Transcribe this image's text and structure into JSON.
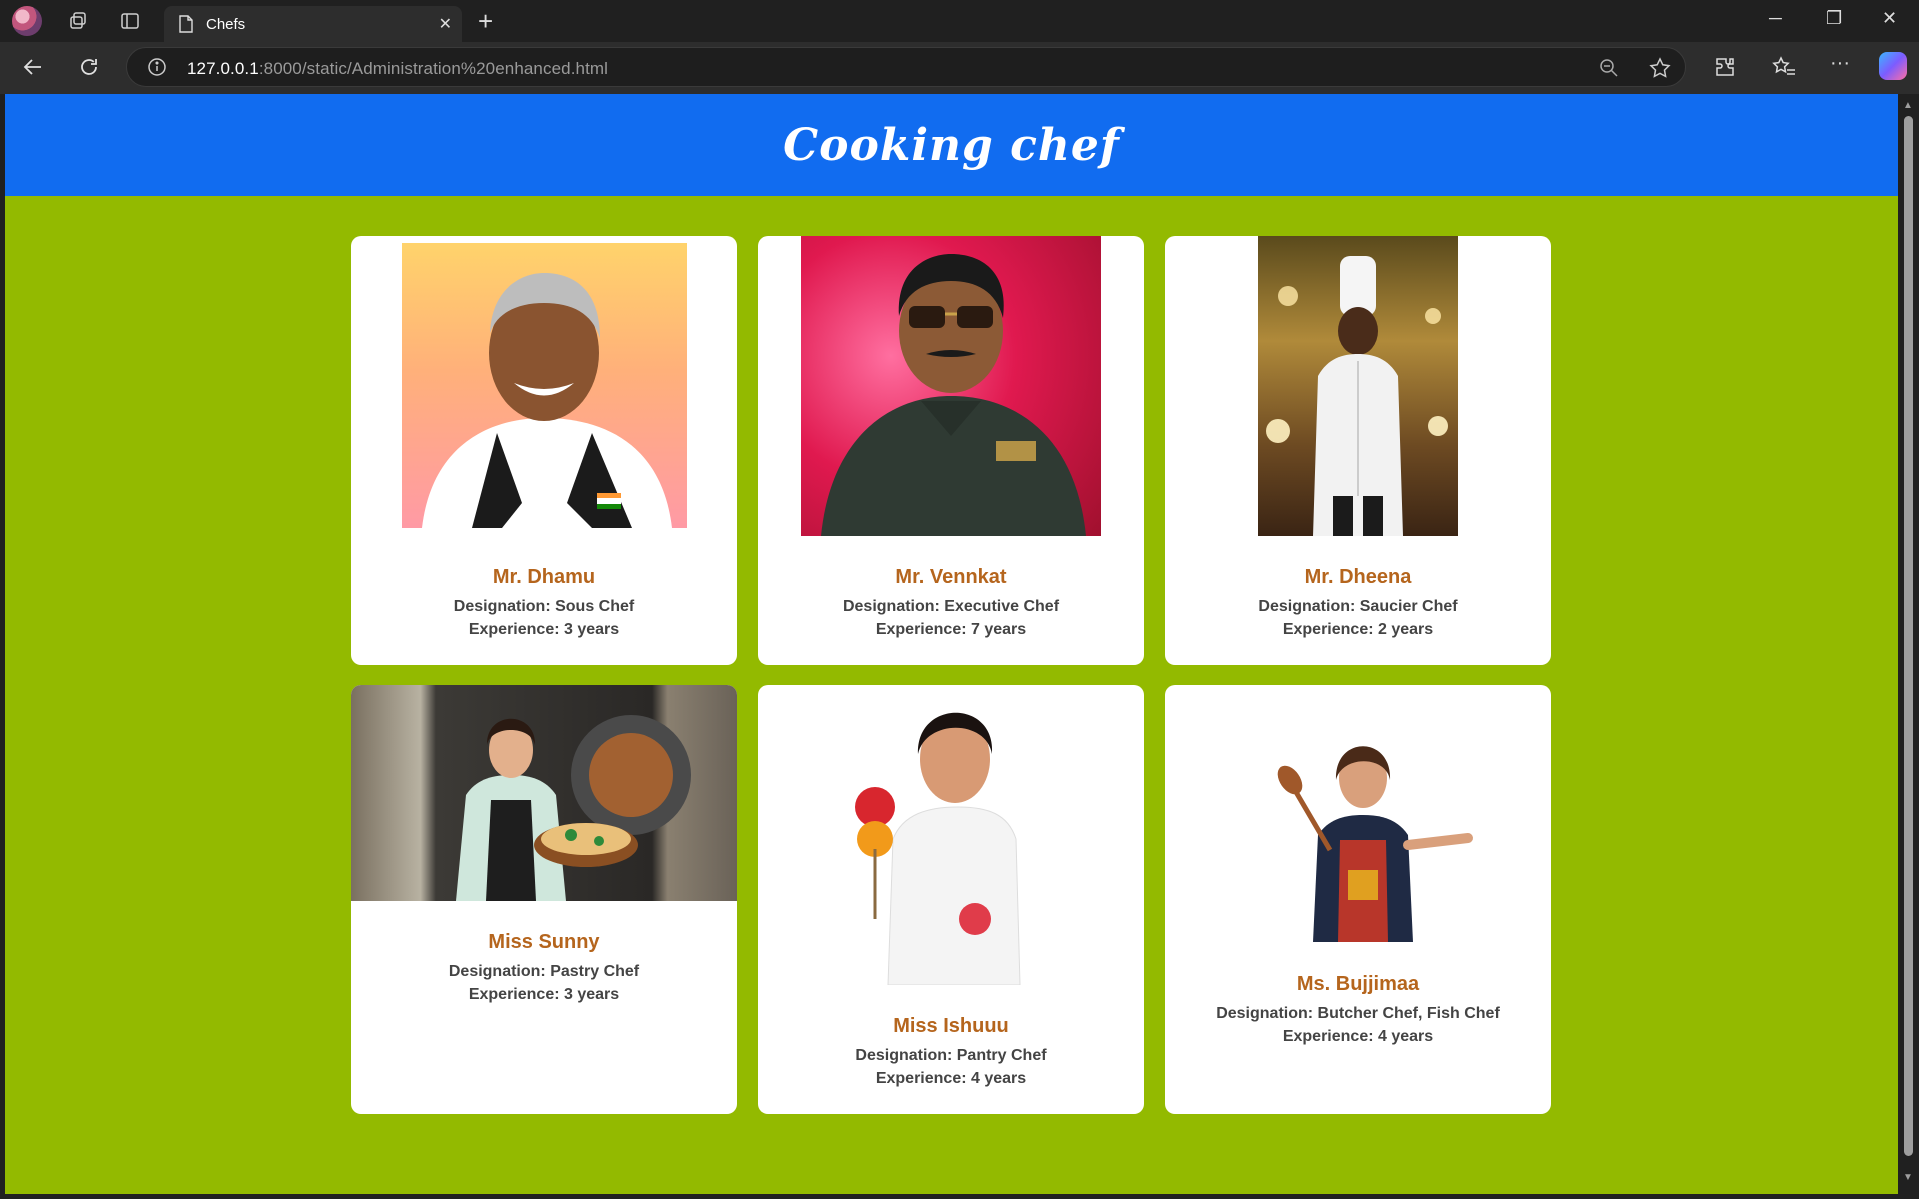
{
  "browser": {
    "tab_title": "Chefs",
    "url_host": "127.0.0.1",
    "url_rest": ":8000/static/Administration%20enhanced.html"
  },
  "page": {
    "heading": "Cooking chef"
  },
  "chefs": [
    {
      "name": "Mr. Dhamu",
      "designation": "Designation: Sous Chef",
      "experience": "Experience: 3 years"
    },
    {
      "name": "Mr. Vennkat",
      "designation": "Designation: Executive Chef",
      "experience": "Experience: 7 years"
    },
    {
      "name": "Mr. Dheena",
      "designation": "Designation: Saucier Chef",
      "experience": "Experience: 2 years"
    },
    {
      "name": "Miss Sunny",
      "designation": "Designation: Pastry Chef",
      "experience": "Experience: 3 years"
    },
    {
      "name": "Miss Ishuuu",
      "designation": "Designation: Pantry Chef",
      "experience": "Experience: 4 years"
    },
    {
      "name": "Ms. Bujjimaa",
      "designation": "Designation: Butcher Chef, Fish Chef",
      "experience": "Experience: 4 years"
    }
  ],
  "colors": {
    "header_bg": "#116cf0",
    "page_bg": "#93ba00",
    "name_color": "#b5651d"
  }
}
